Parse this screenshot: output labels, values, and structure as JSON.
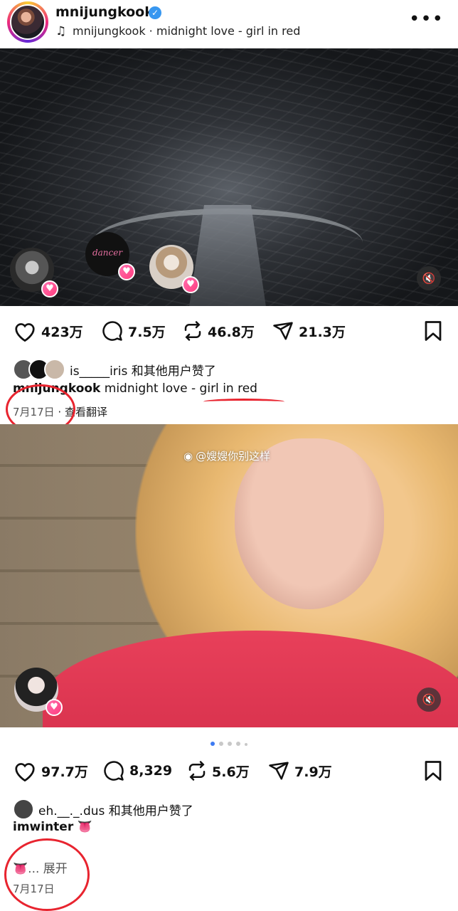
{
  "header": {
    "username": "mnijungkook",
    "audio": "mnijungkook · midnight love - girl in red",
    "music_icon": "music-note-icon",
    "more_icon": "more-horizontal-icon"
  },
  "post1": {
    "story_label": "dancer",
    "actions": {
      "likes": "423万",
      "comments": "7.5万",
      "reposts": "46.8万",
      "shares": "21.3万"
    },
    "liked_by": "is_____iris 和其他用户赞了",
    "caption_user": "mnijungkook",
    "caption_text": "midnight love - girl in red",
    "date": "7月17日",
    "translate": "· 查看翻译"
  },
  "watermark": "@嫂嫂你别这样",
  "post2": {
    "actions": {
      "likes": "97.7万",
      "comments": "8,329",
      "reposts": "5.6万",
      "shares": "7.9万"
    },
    "liked_by": "eh.__._.dus 和其他用户赞了",
    "caption_user": "imwinter",
    "caption_emoji": "👅",
    "more_emoji": "👅",
    "more_text": "... 展开",
    "date": "7月17日"
  },
  "colors": {
    "accent": "#3897f0",
    "annotation": "#e8242f",
    "active_dot": "#3d7bf2"
  }
}
